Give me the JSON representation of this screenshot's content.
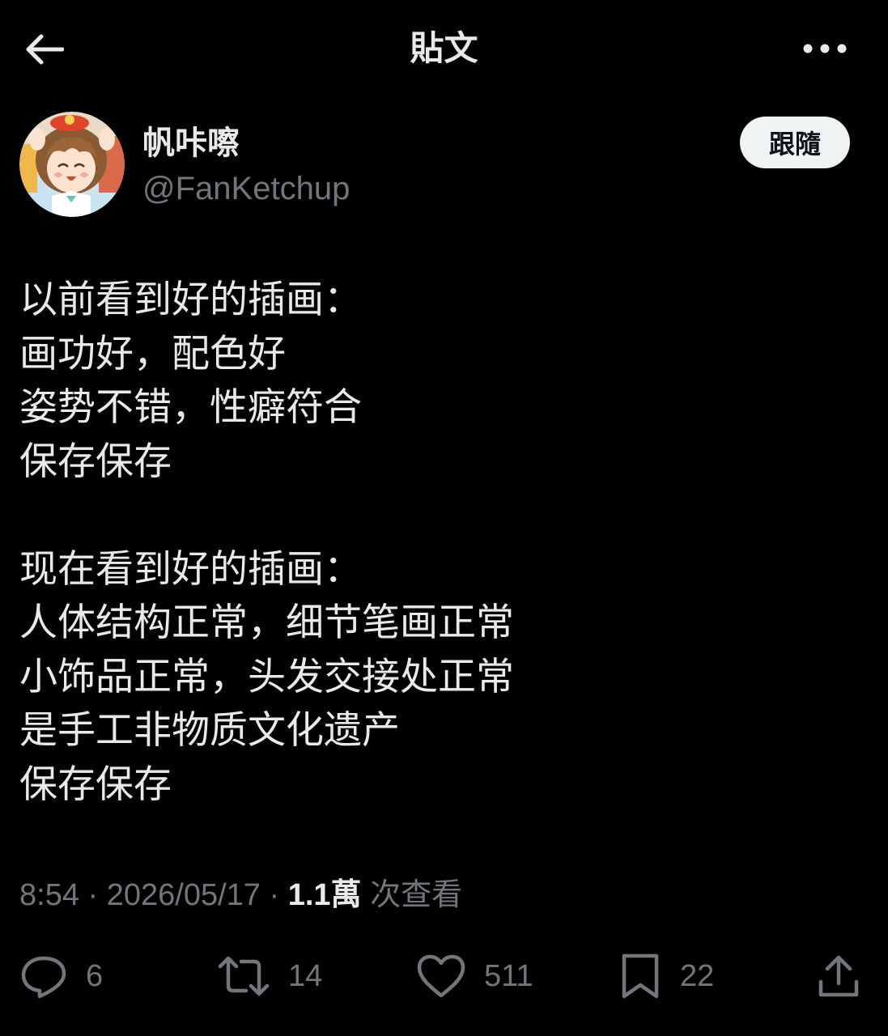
{
  "header": {
    "title": "貼文",
    "back_icon": "arrow-left-icon",
    "more_icon": "more-horizontal-icon"
  },
  "author": {
    "display_name": "帆咔嚓",
    "handle": "@FanKetchup",
    "follow_label": "跟隨"
  },
  "tweet": {
    "lines": [
      "以前看到好的插画：",
      "画功好，配色好",
      "姿势不错，性癖符合",
      "保存保存",
      "",
      "现在看到好的插画：",
      "人体结构正常，细节笔画正常",
      "小饰品正常，头发交接处正常",
      "是手工非物质文化遗产",
      "保存保存"
    ]
  },
  "meta": {
    "time": "8:54",
    "sep1": " · ",
    "date": "2026/05/17",
    "sep2": " · ",
    "views_count": "1.1萬",
    "views_label": " 次查看"
  },
  "actions": {
    "reply": {
      "icon": "reply-icon",
      "count": "6"
    },
    "retweet": {
      "icon": "retweet-icon",
      "count": "14"
    },
    "like": {
      "icon": "heart-icon",
      "count": "511"
    },
    "bookmark": {
      "icon": "bookmark-icon",
      "count": "22"
    },
    "share": {
      "icon": "share-icon"
    }
  },
  "colors": {
    "background": "#000000",
    "primary_text": "#e7e9ea",
    "secondary_text": "#71767b",
    "follow_button_bg": "#eff3f4",
    "follow_button_text": "#0f1419"
  }
}
